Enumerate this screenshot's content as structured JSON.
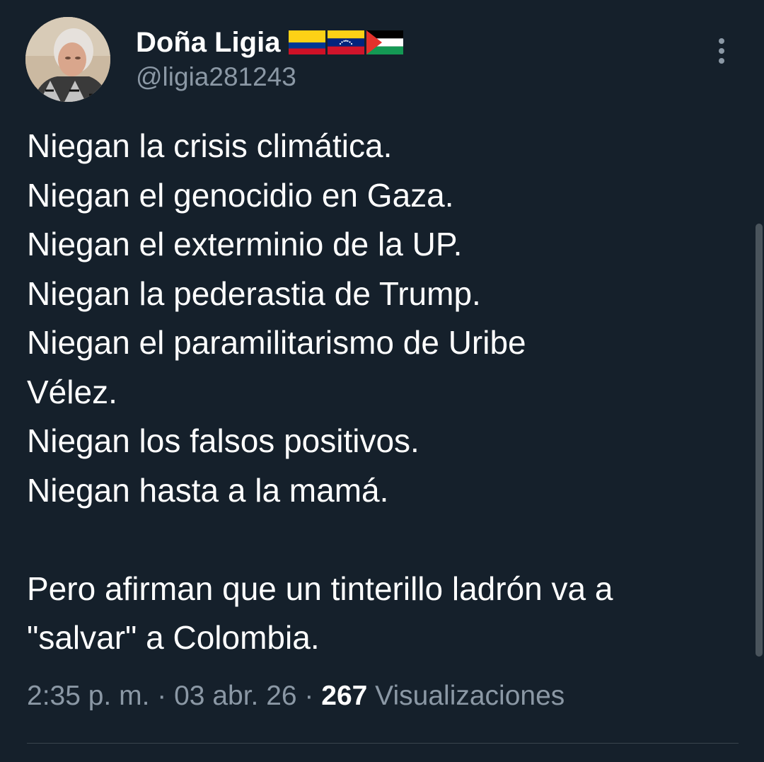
{
  "tweet": {
    "author": {
      "display_name": "Doña Ligia",
      "handle": "@ligia281243",
      "flags": [
        "colombia-flag-icon",
        "venezuela-flag-icon",
        "palestine-flag-icon"
      ]
    },
    "text_lines": [
      "Niegan la crisis climática.",
      "Niegan el genocidio en Gaza.",
      "Niegan el exterminio de la UP.",
      "Niegan la pederastia de Trump.",
      "Niegan el paramilitarismo de Uribe",
      "Vélez.",
      "Niegan los falsos positivos.",
      "Niegan hasta a la mamá.",
      "",
      "Pero afirman que un tinterillo ladrón va a",
      "\"salvar\" a Colombia."
    ],
    "meta": {
      "time": "2:35 p. m.",
      "separator": " · ",
      "date": "03 abr. 26",
      "views_count": "267",
      "views_label": " Visualizaciones"
    }
  },
  "colors": {
    "background": "#15202b",
    "primary_text": "#ffffff",
    "secondary_text": "#8b98a5",
    "divider": "#38444d"
  },
  "icons": {
    "more": "more-vertical-icon",
    "avatar": "avatar"
  }
}
